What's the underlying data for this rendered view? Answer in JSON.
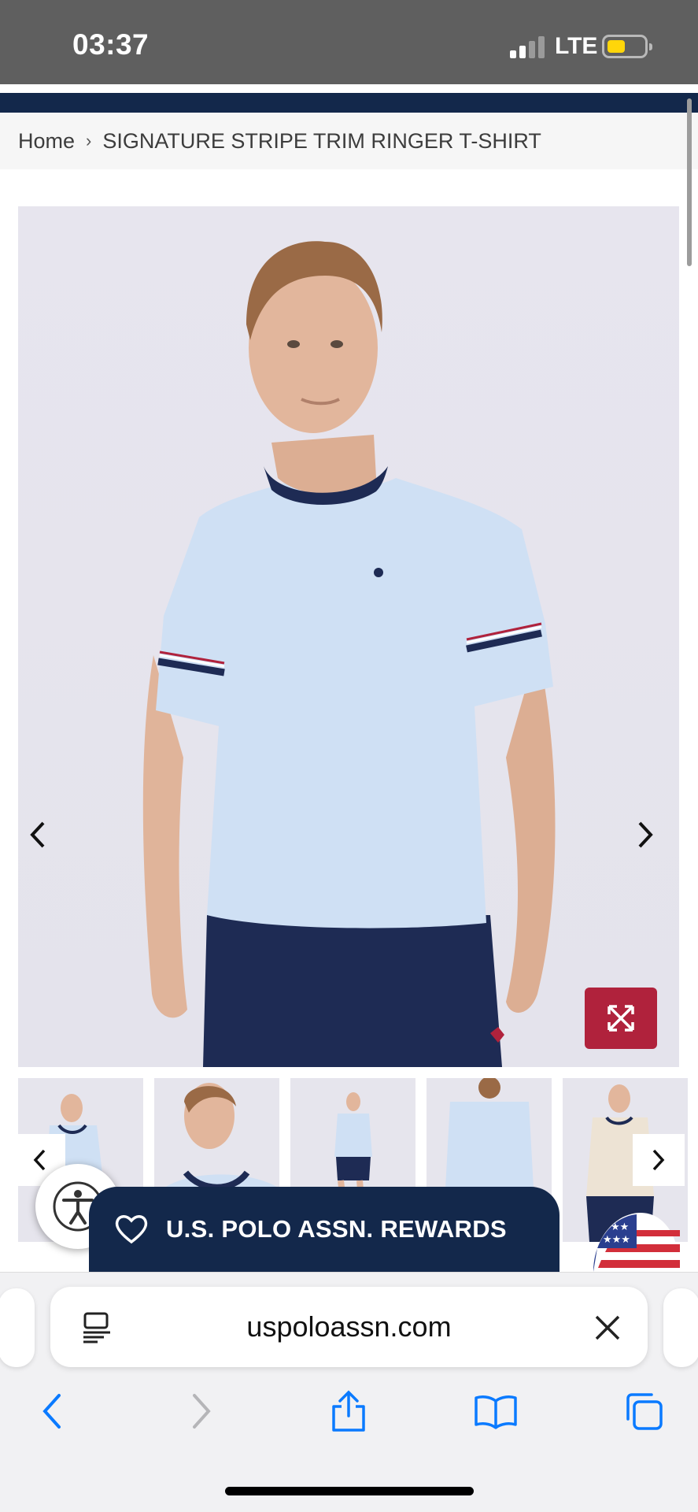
{
  "status_bar": {
    "time": "03:37",
    "network": "LTE",
    "icons": [
      "cellular-signal-icon",
      "battery-icon"
    ]
  },
  "breadcrumb": {
    "home": "Home",
    "separator": "›",
    "current": "SIGNATURE STRIPE TRIM RINGER T-SHIRT"
  },
  "product_gallery": {
    "main_image": "man-in-light-blue-ringer-tshirt",
    "prev_icon": "chevron-left-icon",
    "next_icon": "chevron-right-icon",
    "expand_icon": "expand-arrows-icon",
    "thumbnails": [
      "front-view",
      "closeup-view",
      "full-body-view",
      "back-view",
      "cream-color-view"
    ]
  },
  "rewards": {
    "label": "U.S. POLO ASSN. REWARDS",
    "icon": "heart-outline-icon"
  },
  "browser": {
    "url": "uspoloassn.com",
    "toolbar": [
      "back-icon",
      "forward-icon",
      "share-icon",
      "bookmarks-icon",
      "tabs-icon"
    ]
  },
  "colors": {
    "navy": "#13284b",
    "accent_red": "#b0223c",
    "shirt_blue": "#cfe0f4",
    "link_blue": "#0a7aff"
  }
}
